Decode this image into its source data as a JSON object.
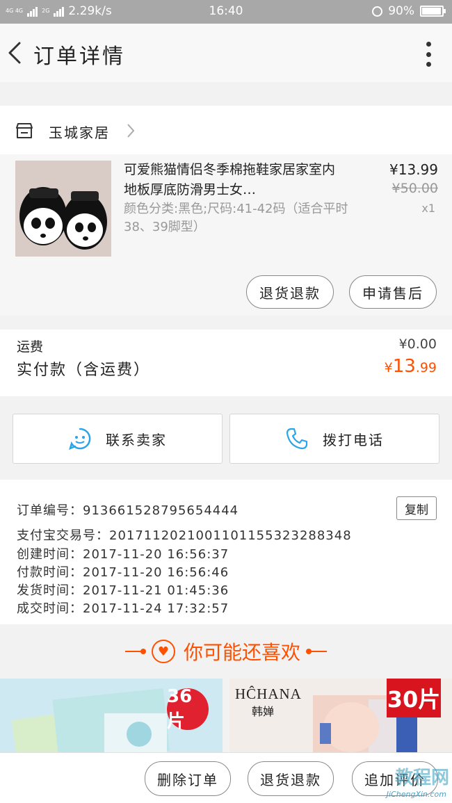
{
  "status_bar": {
    "network_tag": "4G 4G",
    "network_tag2": "2G",
    "speed": "2.29k/s",
    "time": "16:40",
    "battery": "90%",
    "battery_level": 0.9
  },
  "header": {
    "title": "订单详情"
  },
  "shop": {
    "name": "玉城家居"
  },
  "item": {
    "title": "可爱熊猫情侣冬季棉拖鞋家居家室内地板厚底防滑男士女…",
    "sku": "颜色分类:黑色;尺码:41-42码（适合平时38、39脚型）",
    "price": "¥13.99",
    "original_price": "¥50.00",
    "quantity": "x1",
    "refund_label": "退货退款",
    "aftersale_label": "申请售后"
  },
  "fees": {
    "shipping_label": "运费",
    "shipping_value": "¥0.00",
    "paid_label": "实付款（含运费）",
    "paid_currency": "¥",
    "paid_int": "13",
    "paid_dec": ".99"
  },
  "contact": {
    "seller_label": "联系卖家",
    "phone_label": "拨打电话"
  },
  "order_info": {
    "order_no": "订单编号：913661528795654444",
    "copy_label": "复制",
    "alipay_no": "支付宝交易号：2017112021001101155323288348",
    "created": "创建时间：2017-11-20 16:56:37",
    "paid": "付款时间：2017-11-20 16:56:46",
    "shipped": "发货时间：2017-11-21 01:45:36",
    "completed": "成交时间：2017-11-24 17:32:57"
  },
  "recommend": {
    "title": "你可能还喜欢",
    "products": [
      {
        "badge": "36片"
      },
      {
        "brand": "HĈHANA",
        "brand_cn": "韩婵",
        "badge": "30片"
      }
    ]
  },
  "bottom_bar": {
    "delete_label": "删除订单",
    "return_label": "退货退款",
    "review_label": "追加评价"
  },
  "watermark": {
    "text": "教程网",
    "url": "JiChengXin.com"
  }
}
